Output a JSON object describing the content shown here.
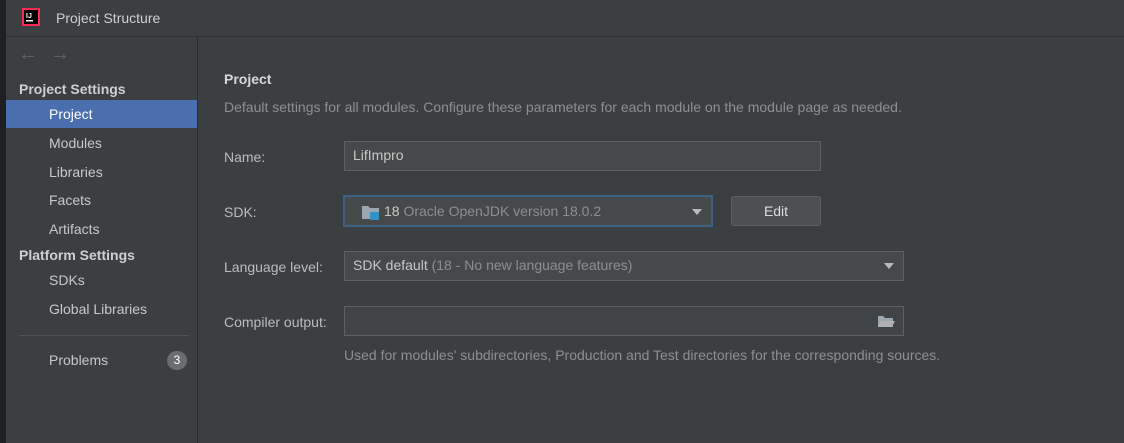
{
  "window": {
    "title": "Project Structure"
  },
  "sidebar": {
    "project_settings_header": "Project Settings",
    "project_items": [
      {
        "label": "Project"
      },
      {
        "label": "Modules"
      },
      {
        "label": "Libraries"
      },
      {
        "label": "Facets"
      },
      {
        "label": "Artifacts"
      }
    ],
    "platform_settings_header": "Platform Settings",
    "platform_items": [
      {
        "label": "SDKs"
      },
      {
        "label": "Global Libraries"
      }
    ],
    "problems": {
      "label": "Problems",
      "count": "3"
    },
    "selected": "Project"
  },
  "main": {
    "heading": "Project",
    "description": "Default settings for all modules. Configure these parameters for each module on the module page as needed.",
    "name": {
      "label": "Name:",
      "value": "LifImpro"
    },
    "sdk": {
      "label": "SDK:",
      "version": "18",
      "detail": "Oracle OpenJDK version 18.0.2",
      "edit_label": "Edit"
    },
    "language_level": {
      "label": "Language level:",
      "value": "SDK default",
      "detail": "(18 - No new language features)"
    },
    "compiler_output": {
      "label": "Compiler output:",
      "value": "",
      "hint": "Used for modules' subdirectories, Production and Test directories for the corresponding sources."
    }
  },
  "colors": {
    "selection": "#4b6eaf",
    "background": "#3c3f41",
    "focus_border": "#3d6185"
  }
}
